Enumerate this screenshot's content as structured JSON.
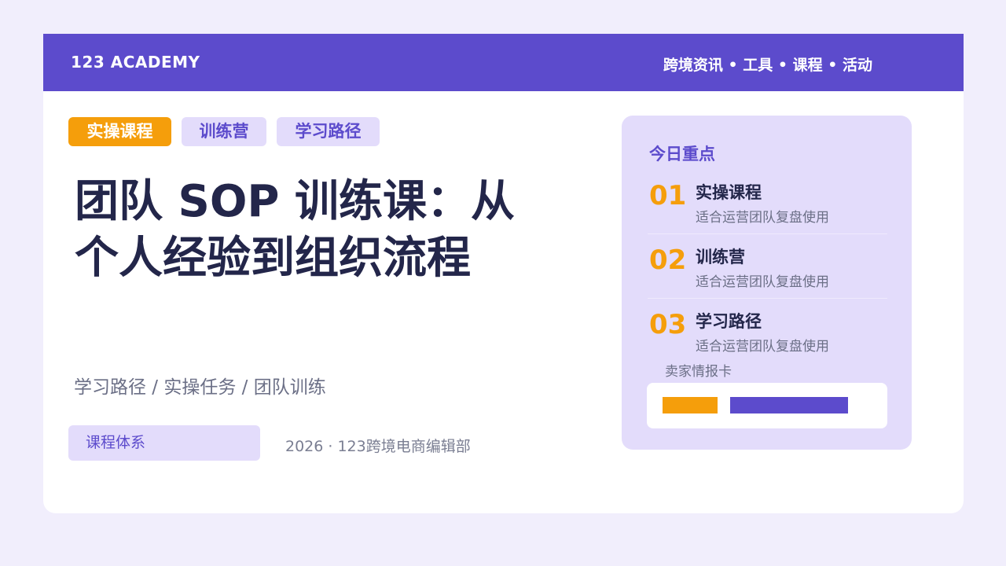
{
  "header": {
    "brand": "123 ACADEMY",
    "nav": "跨境资讯 • 工具 • 课程 • 活动"
  },
  "tags": [
    {
      "label": "实操课程"
    },
    {
      "label": "训练营"
    },
    {
      "label": "学习路径"
    }
  ],
  "main": {
    "title_line1": "团队 SOP 训练课：从",
    "title_line2": "个人经验到组织流程",
    "subtitle": "学习路径 / 实操任务 / 团队训练",
    "pill": "课程体系",
    "credit": "2026 · 123跨境电商编辑部"
  },
  "panel": {
    "title": "今日重点",
    "items": [
      {
        "num": "01",
        "title": "实操课程",
        "desc": "适合运营团队复盘使用"
      },
      {
        "num": "02",
        "title": "训练营",
        "desc": "适合运营团队复盘使用"
      },
      {
        "num": "03",
        "title": "学习路径",
        "desc": "适合运营团队复盘使用"
      }
    ],
    "info_label": "卖家情报卡"
  },
  "colors": {
    "accent": "#5c4bcc",
    "highlight": "#f59e0b",
    "panel_bg": "#e3dcfb",
    "title_text": "#23264a"
  }
}
